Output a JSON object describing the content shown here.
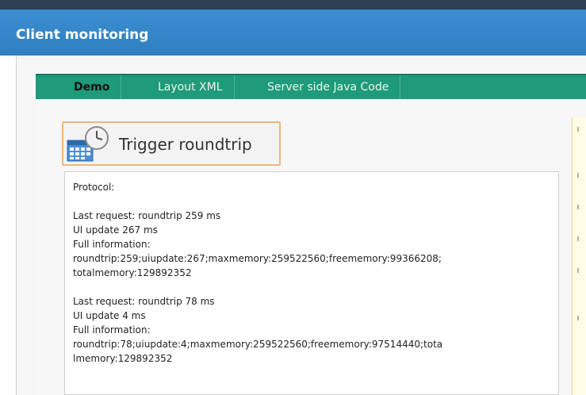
{
  "window": {
    "title": "Client monitoring"
  },
  "tabs": [
    {
      "label": "Demo",
      "active": true
    },
    {
      "label": "Layout XML",
      "active": false
    },
    {
      "label": "Server side Java Code",
      "active": false
    }
  ],
  "demo": {
    "button_label": "Trigger roundtrip",
    "button_icon": "calendar-clock-icon",
    "protocol": {
      "heading": "Protocol:",
      "entries": [
        {
          "last_request": "Last request:  roundtrip 259 ms",
          "ui_update": "UI update 267 ms",
          "full_info_label": "Full information:",
          "full_info_1": "roundtrip:259;uiupdate:267;maxmemory:259522560;freememory:99366208;",
          "full_info_2": "totalmemory:129892352"
        },
        {
          "last_request": "Last request:  roundtrip 78 ms",
          "ui_update": "UI update 4 ms",
          "full_info_label": "Full information:",
          "full_info_1": "roundtrip:78;uiupdate:4;maxmemory:259522560;freememory:97514440;tota",
          "full_info_2": "lmemory:129892352"
        }
      ]
    }
  },
  "colors": {
    "title_bar": "#2f7fc1",
    "tab_bar": "#1f9a7a",
    "button_border": "#f0b67a"
  }
}
